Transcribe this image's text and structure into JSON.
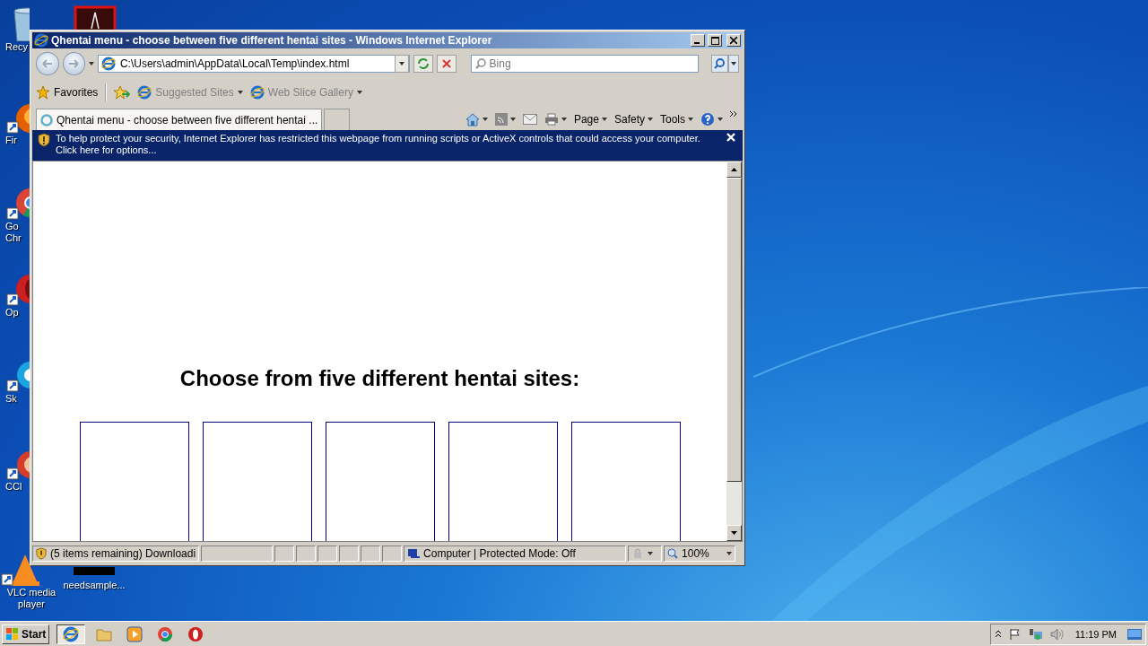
{
  "desktop": {
    "icons": [
      {
        "kind": "bin",
        "lines": [
          "Recy"
        ]
      },
      {
        "kind": "firefox",
        "lines": [
          "Fir"
        ]
      },
      {
        "kind": "chrome",
        "lines": [
          "Go",
          "Chr"
        ]
      },
      {
        "kind": "opera",
        "lines": [
          "Op"
        ]
      },
      {
        "kind": "skype",
        "lines": [
          "Sk"
        ]
      },
      {
        "kind": "ccleaner",
        "lines": [
          "CCl"
        ]
      },
      {
        "kind": "vlc",
        "lines": [
          "VLC media",
          "player"
        ]
      },
      {
        "kind": "pdf"
      },
      {
        "kind": "video",
        "lines": [
          "needsample..."
        ]
      }
    ]
  },
  "window": {
    "title": "Qhentai menu - choose between five different hentai sites - Windows Internet Explorer",
    "address": "C:\\Users\\admin\\AppData\\Local\\Temp\\index.html",
    "search": {
      "placeholder": "Bing"
    },
    "favorites_bar": {
      "label": "Favorites",
      "links": [
        "Suggested Sites",
        "Web Slice Gallery"
      ]
    },
    "tabs": [
      {
        "label": "Qhentai menu - choose between five different hentai ...",
        "selected": true
      }
    ],
    "command_bar": [
      "Page",
      "Safety",
      "Tools"
    ],
    "info_bar": {
      "text": "To help protect your security, Internet Explorer has restricted this webpage from running scripts or ActiveX controls that could access your computer. Click here for options..."
    },
    "page": {
      "heading": "Choose from five different hentai sites:",
      "tiles": [
        {
          "kind": "blank"
        },
        {
          "kind": "blank"
        },
        {
          "kind": "blank"
        },
        {
          "kind": "blank"
        },
        {
          "kind": "blank"
        }
      ]
    },
    "status_bar": {
      "text": "(5 items remaining) Downloadi",
      "zone": "Computer | Protected Mode: Off",
      "zoom": "100%"
    }
  },
  "taskbar": {
    "start": "Start",
    "apps": [
      {
        "kind": "ie",
        "selected": true
      },
      {
        "kind": "explorer",
        "selected": false
      },
      {
        "kind": "player",
        "selected": false
      },
      {
        "kind": "chrome",
        "selected": false
      },
      {
        "kind": "opera",
        "selected": false
      }
    ],
    "clock": "11:19 PM"
  }
}
